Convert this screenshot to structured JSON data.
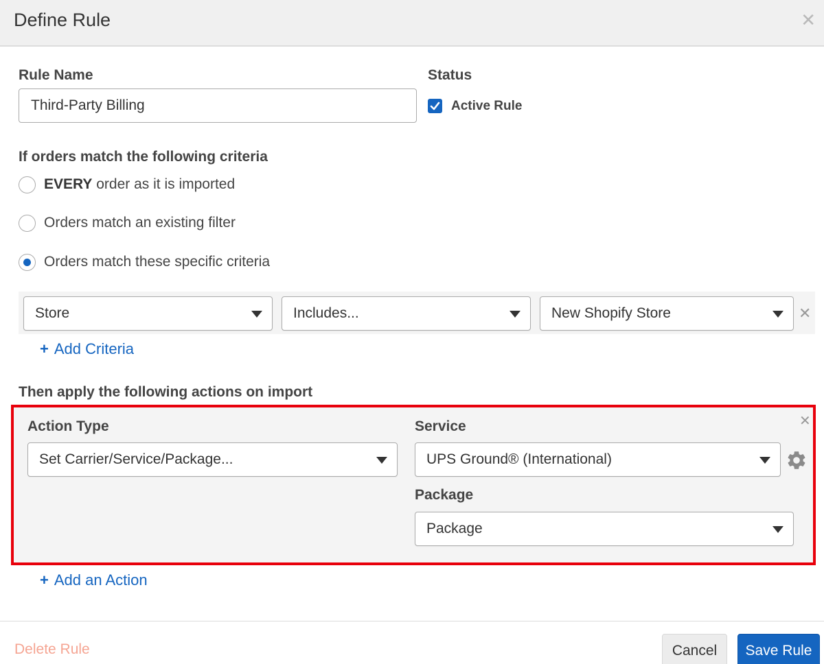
{
  "dialog": {
    "title": "Define Rule"
  },
  "rule_name": {
    "label": "Rule Name",
    "value": "Third-Party Billing"
  },
  "status": {
    "label": "Status",
    "checkbox_label": "Active Rule",
    "checked": true
  },
  "criteria": {
    "heading": "If orders match the following criteria",
    "options": [
      {
        "bold": "EVERY",
        "text": " order as it is imported",
        "selected": false
      },
      {
        "bold": "",
        "text": "Orders match an existing filter",
        "selected": false
      },
      {
        "bold": "",
        "text": "Orders match these specific criteria",
        "selected": true
      }
    ],
    "row": {
      "field": "Store",
      "operator": "Includes...",
      "value": "New Shopify Store"
    },
    "add_label": "Add Criteria"
  },
  "actions": {
    "heading": "Then apply the following actions on import",
    "action_type_label": "Action Type",
    "action_type_value": "Set Carrier/Service/Package...",
    "service_label": "Service",
    "service_value": "UPS Ground® (International)",
    "package_label": "Package",
    "package_value": "Package",
    "add_label": "Add an Action"
  },
  "footer": {
    "delete_label": "Delete Rule",
    "cancel_label": "Cancel",
    "save_label": "Save Rule"
  },
  "colors": {
    "accent": "#1565c0",
    "highlight_border": "#e8000b",
    "delete_text": "#f5a593"
  },
  "icons": [
    "close-icon",
    "checkmark-icon",
    "chevron-down-icon",
    "plus-icon",
    "gear-icon"
  ]
}
